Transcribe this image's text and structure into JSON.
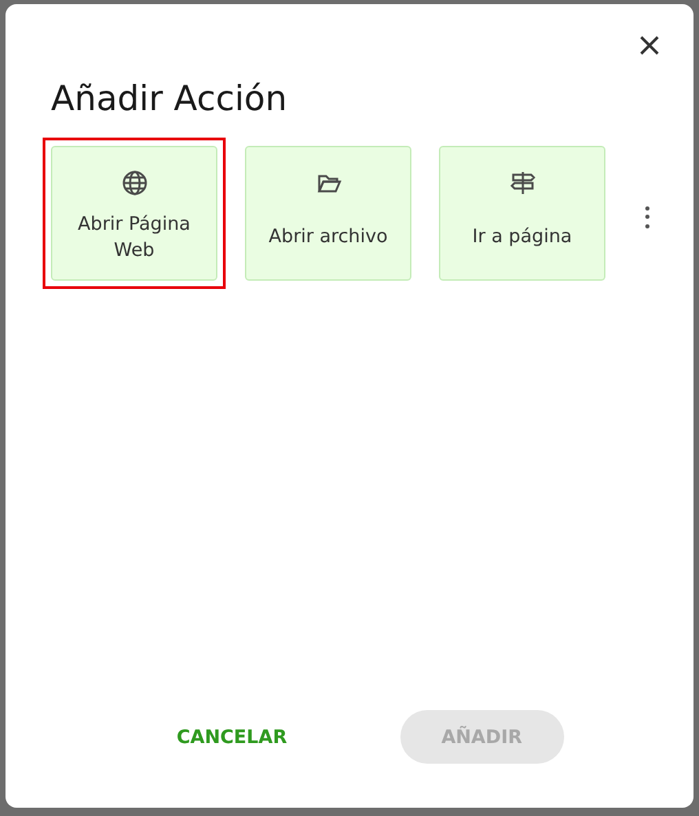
{
  "dialog": {
    "title": "Añadir Acción"
  },
  "actions": [
    {
      "kind": "globe",
      "label": "Abrir Página Web",
      "selected": true
    },
    {
      "kind": "folder",
      "label": "Abrir archivo",
      "selected": false
    },
    {
      "kind": "signpost",
      "label": "Ir a página",
      "selected": false
    }
  ],
  "buttons": [
    {
      "label": "CANCELAR",
      "disabled": false
    },
    {
      "label": "AÑADIR",
      "disabled": true
    }
  ]
}
